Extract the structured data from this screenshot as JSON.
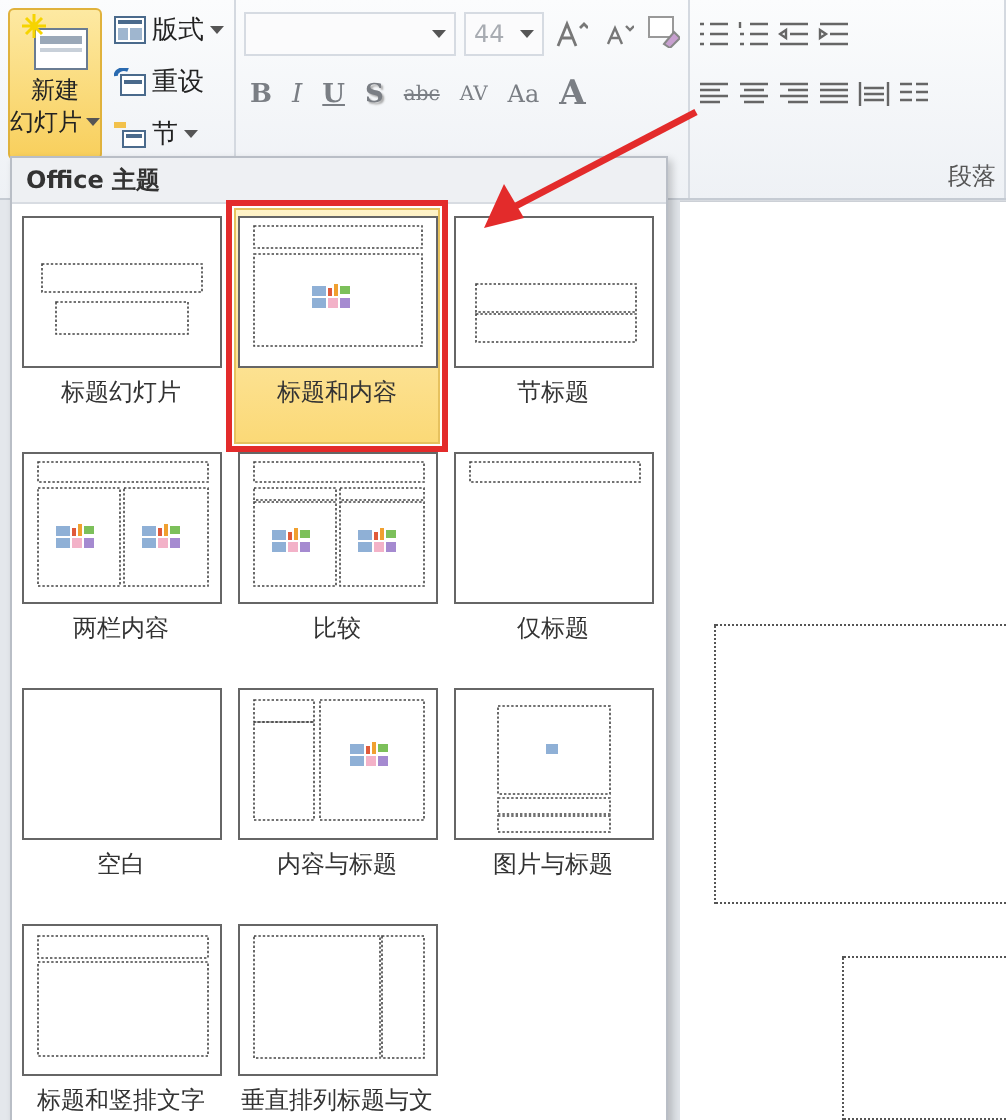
{
  "ribbon": {
    "new_slide": {
      "line1": "新建",
      "line2": "幻灯片",
      "selected": true
    },
    "slide_buttons": [
      {
        "label": "版式",
        "has_menu": true,
        "kind": "layout"
      },
      {
        "label": "重设",
        "has_menu": false,
        "kind": "reset"
      },
      {
        "label": "节",
        "has_menu": true,
        "kind": "section"
      }
    ],
    "font": {
      "size": "44"
    },
    "format_buttons": [
      {
        "label": "B",
        "kind": "bold"
      },
      {
        "label": "I",
        "kind": "italic"
      },
      {
        "label": "U",
        "kind": "underline"
      },
      {
        "label": "S",
        "kind": "shadow"
      },
      {
        "label": "abc",
        "kind": "strike"
      },
      {
        "label": "AV",
        "kind": "spacing"
      },
      {
        "label": "Aa",
        "kind": "case"
      },
      {
        "label": "A",
        "kind": "color"
      }
    ],
    "paragraph_group": {
      "label": "段落"
    }
  },
  "layout_menu": {
    "title": "Office 主题",
    "layouts": [
      {
        "label": "标题幻灯片",
        "kind": "title_slide",
        "selected": false
      },
      {
        "label": "标题和内容",
        "kind": "title_content",
        "selected": true
      },
      {
        "label": "节标题",
        "kind": "section_header",
        "selected": false
      },
      {
        "label": "两栏内容",
        "kind": "two_content",
        "selected": false
      },
      {
        "label": "比较",
        "kind": "comparison",
        "selected": false
      },
      {
        "label": "仅标题",
        "kind": "title_only",
        "selected": false
      },
      {
        "label": "空白",
        "kind": "blank",
        "selected": false
      },
      {
        "label": "内容与标题",
        "kind": "content_caption",
        "selected": false
      },
      {
        "label": "图片与标题",
        "kind": "picture_caption",
        "selected": false
      },
      {
        "label": "标题和竖排文字",
        "kind": "title_vertical_text",
        "selected": false
      },
      {
        "label": "垂直排列标题与文",
        "kind": "vertical_title_text",
        "selected": false
      }
    ]
  }
}
